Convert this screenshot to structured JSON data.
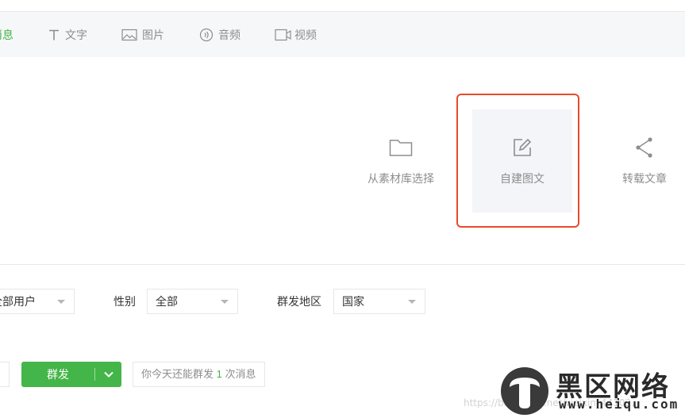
{
  "tabs": [
    {
      "label": "图文消息",
      "icon": "news-icon",
      "active": true
    },
    {
      "label": "文字",
      "icon": "text-icon"
    },
    {
      "label": "图片",
      "icon": "image-icon"
    },
    {
      "label": "音频",
      "icon": "audio-icon"
    },
    {
      "label": "视频",
      "icon": "video-icon"
    }
  ],
  "choices": [
    {
      "label": "从素材库选择",
      "icon": "folder-icon"
    },
    {
      "label": "自建图文",
      "icon": "edit-icon"
    },
    {
      "label": "转载文章",
      "icon": "share-icon"
    }
  ],
  "filters": {
    "group_value": "全部用户",
    "gender_label": "性别",
    "gender_value": "全部",
    "region_label": "群发地区",
    "region_value": "国家"
  },
  "actions": {
    "send_label": "群发",
    "tip_prefix": "你今天还能群发",
    "tip_count": "1",
    "tip_suffix": "次消息"
  },
  "watermark": {
    "url": "https://blog.csdn.net/weixin_44103...",
    "brand_cn": "黑区网络",
    "brand_en": "www.heiqu.com"
  },
  "colors": {
    "accent": "#44b549",
    "highlight": "#e84a2c"
  }
}
